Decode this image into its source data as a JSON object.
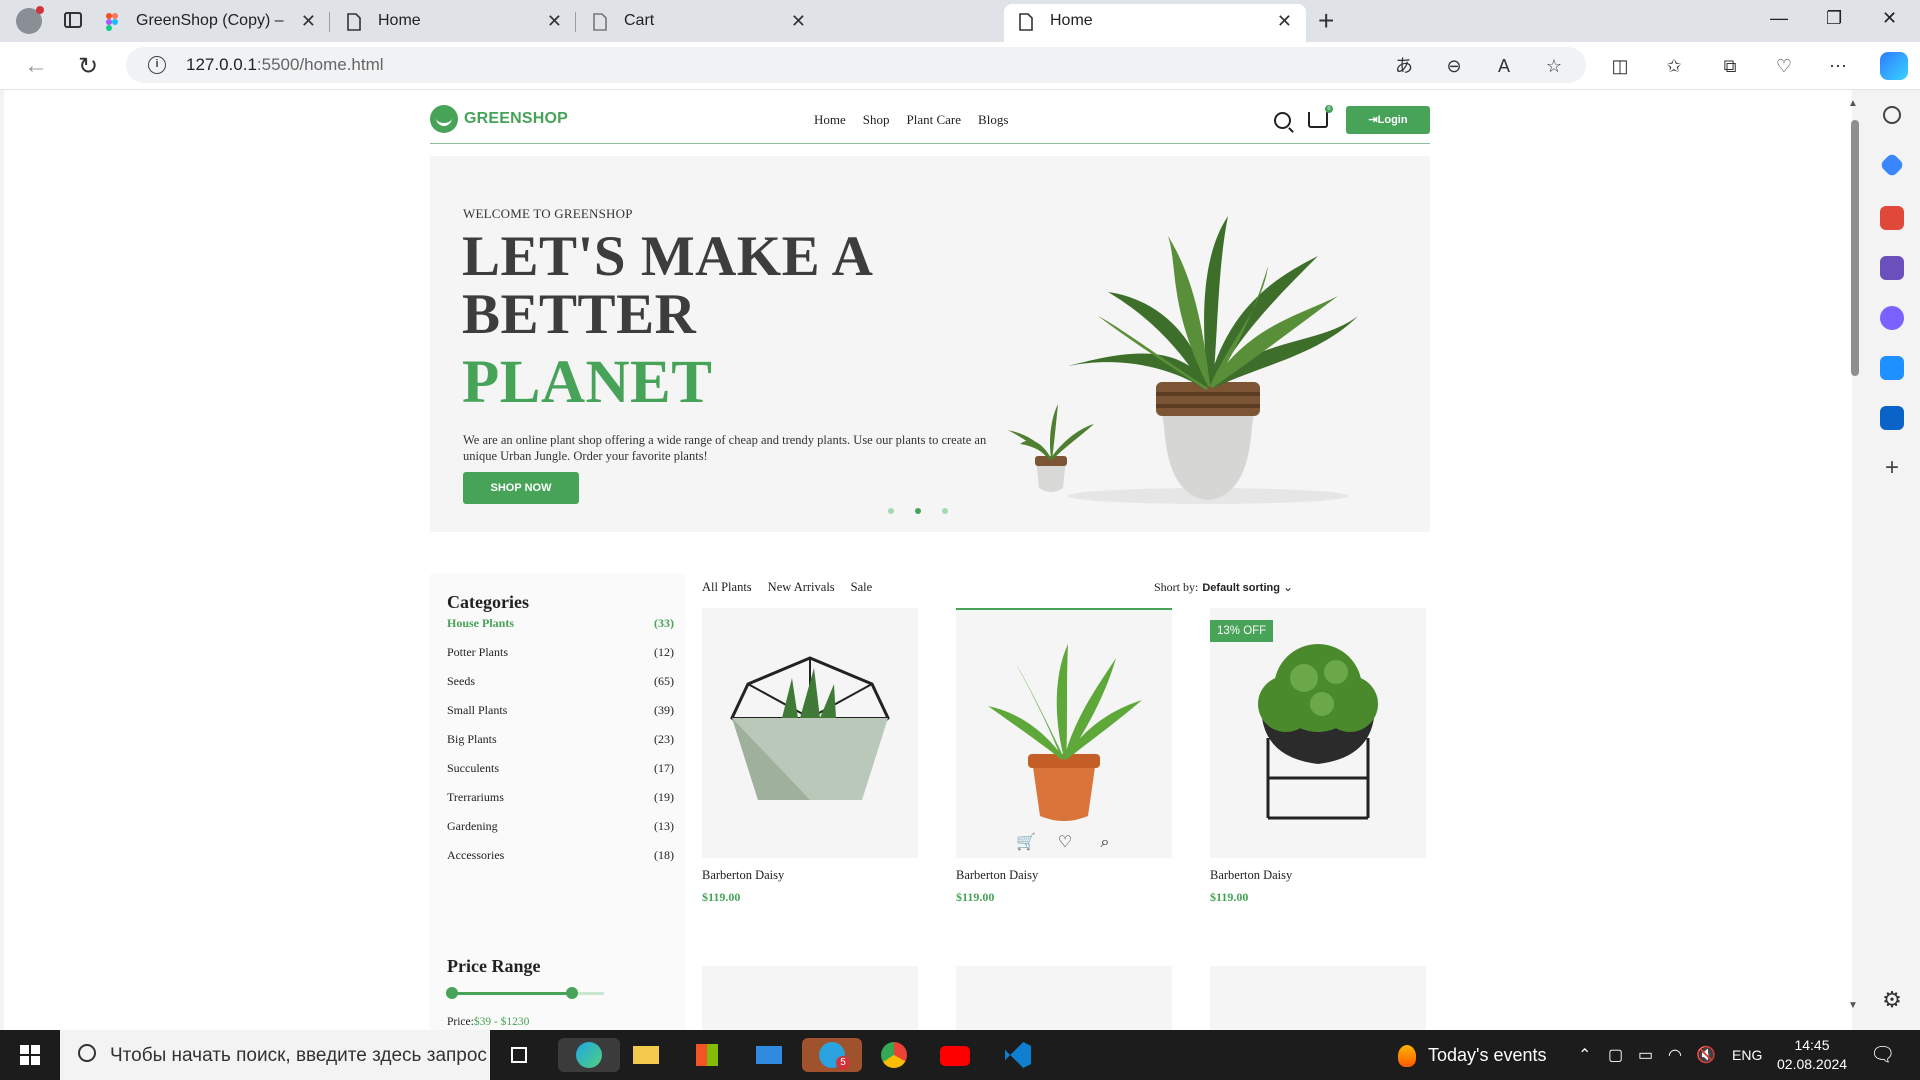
{
  "browser": {
    "tabs": [
      {
        "title": "GreenShop (Copy) – Figma",
        "active": false
      },
      {
        "title": "Home",
        "active": false
      },
      {
        "title": "Cart",
        "active": false
      },
      {
        "title": "Home",
        "active": true
      }
    ],
    "url_host": "127.0.0.1",
    "url_rest": ":5500/home.html"
  },
  "site": {
    "brand": "GREENSHOP",
    "nav": [
      "Home",
      "Shop",
      "Plant Care",
      "Blogs"
    ],
    "login_label": "Login",
    "cart_badge": "0",
    "hero": {
      "kicker": "WELCOME TO GREENSHOP",
      "title_line1": "LET'S MAKE A",
      "title_line2": "BETTER",
      "title_accent": "PLANET",
      "description": "We are an online plant shop offering a wide range of cheap and trendy plants. Use our plants to create an unique Urban Jungle. Order your favorite plants!",
      "cta": "SHOP NOW"
    },
    "categories_title": "Categories",
    "categories": [
      {
        "name": "House Plants",
        "count": "(33)",
        "active": true
      },
      {
        "name": "Potter Plants",
        "count": "(12)"
      },
      {
        "name": "Seeds",
        "count": "(65)"
      },
      {
        "name": "Small Plants",
        "count": "(39)"
      },
      {
        "name": "Big Plants",
        "count": "(23)"
      },
      {
        "name": "Succulents",
        "count": "(17)"
      },
      {
        "name": "Trerrariums",
        "count": "(19)"
      },
      {
        "name": "Gardening",
        "count": "(13)"
      },
      {
        "name": "Accessories",
        "count": "(18)"
      }
    ],
    "price_range_title": "Price Range",
    "price_label": "Price:",
    "price_value": "$39 - $1230",
    "filters": [
      "All Plants",
      "New Arrivals",
      "Sale"
    ],
    "sort_label": "Short by:",
    "sort_value": "Default sorting",
    "products": [
      {
        "name": "Barberton Daisy",
        "price": "$119.00",
        "badge": ""
      },
      {
        "name": "Barberton Daisy",
        "price": "$119.00",
        "badge": ""
      },
      {
        "name": "Barberton Daisy",
        "price": "$119.00",
        "badge": "13% OFF"
      }
    ]
  },
  "taskbar": {
    "search_placeholder": "Чтобы начать поиск, введите здесь запрос",
    "events": "Today's events",
    "lang": "ENG",
    "time": "14:45",
    "date": "02.08.2024",
    "telegram_badge": "5"
  },
  "colors": {
    "accent": "#46a358",
    "title": "#3d3d3d"
  }
}
